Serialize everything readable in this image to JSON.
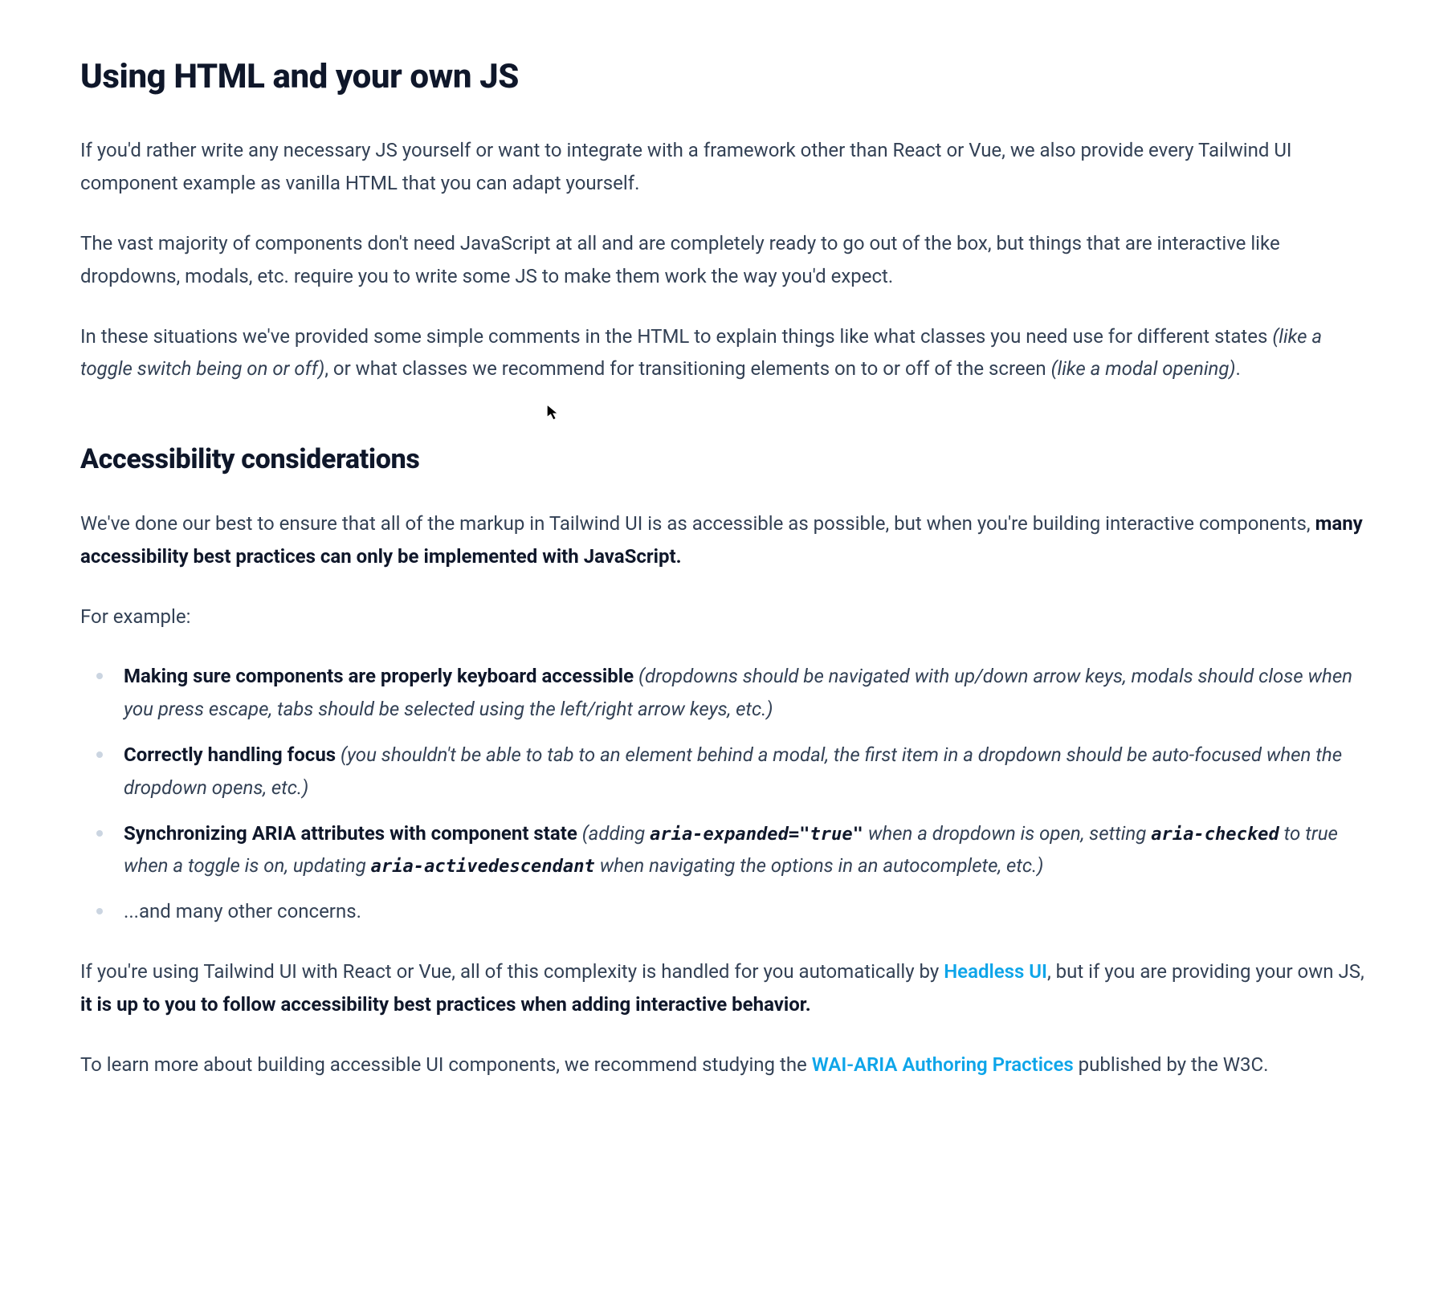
{
  "section1": {
    "title": "Using HTML and your own JS",
    "p1": "If you'd rather write any necessary JS yourself or want to integrate with a framework other than React or Vue, we also provide every Tailwind UI component example as vanilla HTML that you can adapt yourself.",
    "p2": "The vast majority of components don't need JavaScript at all and are completely ready to go out of the box, but things that are interactive like dropdowns, modals, etc. require you to write some JS to make them work the way you'd expect.",
    "p3_a": "In these situations we've provided some simple comments in the HTML to explain things like what classes you need use for different states ",
    "p3_i1": "(like a toggle switch being on or off)",
    "p3_b": ", or what classes we recommend for transitioning elements on to or off of the screen ",
    "p3_i2": "(like a modal opening)",
    "p3_c": "."
  },
  "section2": {
    "title": "Accessibility considerations",
    "p1_a": "We've done our best to ensure that all of the markup in Tailwind UI is as accessible as possible, but when you're building interactive components, ",
    "p1_b": "many accessibility best practices can only be implemented with JavaScript.",
    "p2": "For example:",
    "bullets": [
      {
        "bold": "Making sure components are properly keyboard accessible",
        "italic": " (dropdowns should be navigated with up/down arrow keys, modals should close when you press escape, tabs should be selected using the left/right arrow keys, etc.)"
      },
      {
        "bold": "Correctly handling focus",
        "italic": " (you shouldn't be able to tab to an element behind a modal, the first item in a dropdown should be auto-focused when the dropdown opens, etc.)"
      }
    ],
    "bullet3": {
      "bold": "Synchronizing ARIA attributes with component state",
      "i_a": " (adding ",
      "code1": "aria-expanded=\"true\"",
      "i_b": " when a dropdown is open, setting ",
      "code2": "aria-checked",
      "i_c": " to true when a toggle is on, updating ",
      "code3": "aria-activedescendant",
      "i_d": " when navigating the options in an autocomplete, etc.)"
    },
    "bullet4": "...and many other concerns.",
    "p3_a": "If you're using Tailwind UI with React or Vue, all of this complexity is handled for you automatically by ",
    "p3_link": "Headless UI",
    "p3_b": ", but if you are providing your own JS, ",
    "p3_bold": "it is up to you to follow accessibility best practices when adding interactive behavior.",
    "p4_a": "To learn more about building accessible UI components, we recommend studying the ",
    "p4_link": "WAI-ARIA Authoring Practices",
    "p4_b": " published by the W3C."
  }
}
